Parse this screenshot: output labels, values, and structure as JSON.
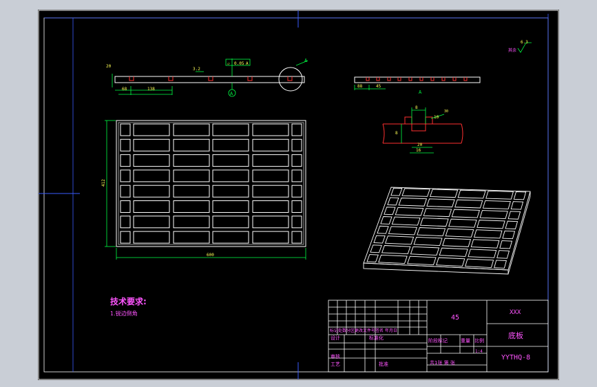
{
  "drawing": {
    "tech_heading": "技术要求:",
    "tech_note": "1.锐边倒角",
    "roughness_prefix": "其余",
    "roughness_value": "6.3",
    "section_label": "A",
    "detail_label": "A",
    "flatness": "0.05",
    "flat_sym": "▱",
    "datum_ref": "A",
    "roughness_local": "3.2",
    "dims": {
      "height_20": "20",
      "d68": "68",
      "d138": "138",
      "d412": "412",
      "d600": "600",
      "d88": "88",
      "d45": "45",
      "d8a": "8",
      "d10": "10",
      "d8b": "8",
      "d20": "20",
      "d16": "16",
      "d30": "30"
    }
  },
  "title_block": {
    "material": "45",
    "company": "XXX",
    "part_name": "底板",
    "drawing_no": "YYTHQ-8",
    "scale": "1:4",
    "scale_label": "比例",
    "stage_mark": "阶段标记",
    "weight": "重量",
    "sheets": "共1张  第  张",
    "rev_header": "标记处数分区更改文件号签名 年月日",
    "design": "设计",
    "standard": "标准化",
    "review": "审核",
    "process": "工艺",
    "approve": "批准"
  }
}
